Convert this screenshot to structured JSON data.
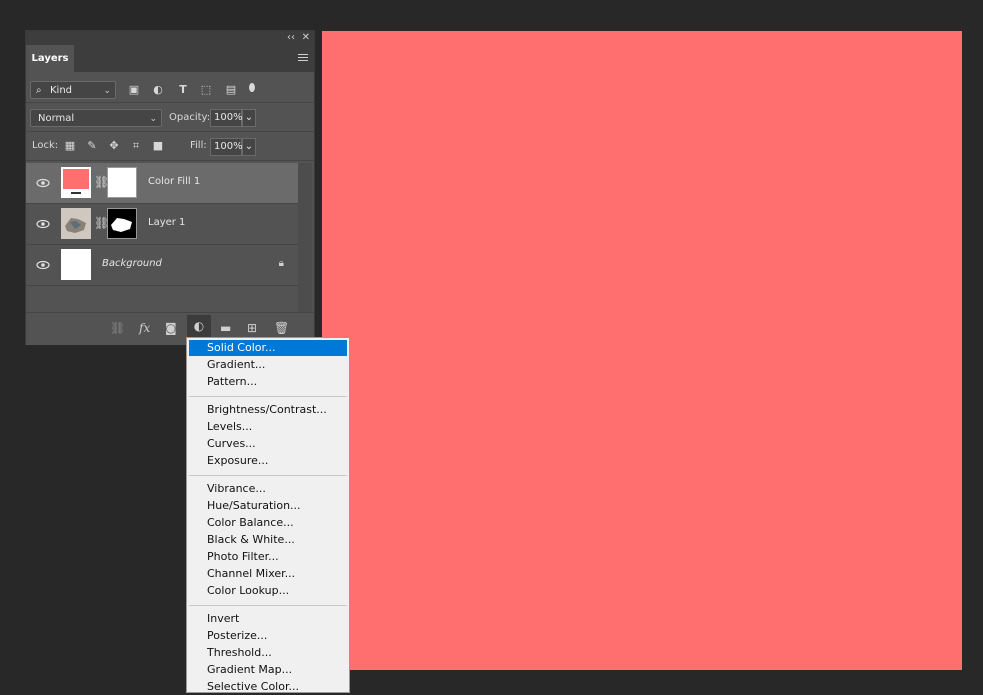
{
  "canvas": {
    "fill_color": "#ff6f6f"
  },
  "panel": {
    "tab_label": "Layers",
    "collapse_icon": "double-chevron-left-icon",
    "close_icon": "close-icon",
    "filter": {
      "kind_label": "Kind",
      "icons": [
        "image-filter-icon",
        "adjustment-filter-icon",
        "type-filter-icon",
        "shape-filter-icon",
        "smart-object-filter-icon",
        "filter-toggle-icon"
      ]
    },
    "blend": {
      "mode": "Normal",
      "opacity_label": "Opacity:",
      "opacity_value": "100%"
    },
    "lock": {
      "label": "Lock:",
      "fill_label": "Fill:",
      "fill_value": "100%"
    },
    "layers": [
      {
        "name": "Color Fill 1",
        "selected": true
      },
      {
        "name": "Layer 1",
        "selected": false
      },
      {
        "name": "Background",
        "selected": false,
        "locked": true
      }
    ],
    "footer": [
      "link-layers-icon",
      "fx-icon",
      "layer-mask-icon",
      "adjustment-layer-icon",
      "group-folder-icon",
      "new-layer-icon",
      "trash-icon"
    ]
  },
  "menu": {
    "groups": [
      [
        "Solid Color...",
        "Gradient...",
        "Pattern..."
      ],
      [
        "Brightness/Contrast...",
        "Levels...",
        "Curves...",
        "Exposure..."
      ],
      [
        "Vibrance...",
        "Hue/Saturation...",
        "Color Balance...",
        "Black & White...",
        "Photo Filter...",
        "Channel Mixer...",
        "Color Lookup..."
      ],
      [
        "Invert",
        "Posterize...",
        "Threshold...",
        "Gradient Map...",
        "Selective Color..."
      ]
    ],
    "highlighted": "Solid Color..."
  }
}
